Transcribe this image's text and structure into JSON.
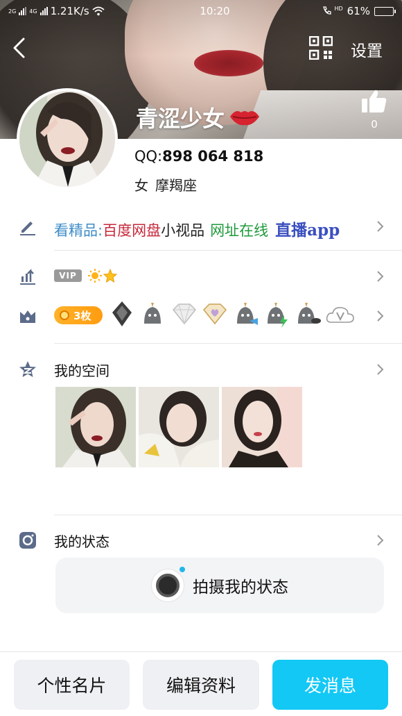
{
  "status_bar": {
    "network_left": "2G",
    "network_right": "4G",
    "speed": "1.21K/s",
    "time": "10:20",
    "hd_label": "HD",
    "battery_percent": 61,
    "battery_text": "61%"
  },
  "nav": {
    "back_icon": "chevron-left-icon",
    "qr_icon": "qr-code-icon",
    "settings_label": "设置"
  },
  "profile": {
    "nickname": "青涩少女",
    "nickname_emoji": "💋",
    "likes_count": "0",
    "qq_prefix": "QQ:",
    "qq_number": "898 064 818",
    "gender": "女",
    "constellation": "摩羯座"
  },
  "signature": {
    "part1": "看精品:",
    "part2": "百度网盘",
    "part3": "小视品",
    "part4": "网址在线",
    "part5": "直播app"
  },
  "vip_row": {
    "badge": "VIP",
    "icons": [
      "sun-icon",
      "star-icon"
    ]
  },
  "medals_row": {
    "count_label": "3枚"
  },
  "space": {
    "title": "我的空间"
  },
  "status_section": {
    "title": "我的状态",
    "shoot_label": "拍摄我的状态"
  },
  "bottom_bar": {
    "card_label": "个性名片",
    "edit_label": "编辑资料",
    "message_label": "发消息"
  },
  "colors": {
    "accent_blue": "#13c8f5",
    "vip_gray": "#9a9a9a",
    "medal_orange": "#ffa41a",
    "icon_gray": "#5c6b8a"
  }
}
